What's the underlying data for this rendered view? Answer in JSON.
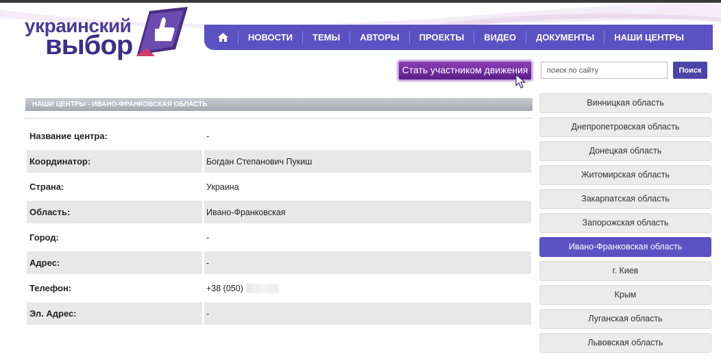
{
  "logo": {
    "line1": "украинский",
    "line2": "выбор"
  },
  "nav": {
    "items": [
      {
        "label": "НОВОСТИ"
      },
      {
        "label": "ТЕМЫ"
      },
      {
        "label": "АВТОРЫ"
      },
      {
        "label": "ПРОЕКТЫ"
      },
      {
        "label": "ВИДЕО"
      },
      {
        "label": "ДОКУМЕНТЫ"
      },
      {
        "label": "НАШИ ЦЕНТРЫ"
      }
    ]
  },
  "join_button": "Стать участником движения",
  "search": {
    "placeholder": "поиск по сайту",
    "button_label": "Поиск"
  },
  "section_title": "НАШИ ЦЕНТРЫ - ИВАНО-ФРАНКОВСКАЯ ОБЛАСТЬ",
  "info_rows": [
    {
      "label": "Название центра:",
      "value": "-"
    },
    {
      "label": "Координатор:",
      "value": "Богдан Степанович Пукиш"
    },
    {
      "label": "Страна:",
      "value": "Украина"
    },
    {
      "label": "Область:",
      "value": "Ивано-Франковская"
    },
    {
      "label": "Город:",
      "value": "-"
    },
    {
      "label": "Адрес:",
      "value": "-"
    },
    {
      "label": "Телефон:",
      "value": "+38 (050)"
    },
    {
      "label": "Эл. Адрес:",
      "value": "-"
    }
  ],
  "regions": [
    {
      "label": "Винницкая область",
      "active": false
    },
    {
      "label": "Днепропетровская область",
      "active": false
    },
    {
      "label": "Донецкая область",
      "active": false
    },
    {
      "label": "Житомирская область",
      "active": false
    },
    {
      "label": "Закарпатская область",
      "active": false
    },
    {
      "label": "Запорожская область",
      "active": false
    },
    {
      "label": "Ивано-Франковская область",
      "active": true
    },
    {
      "label": "г. Киев",
      "active": false
    },
    {
      "label": "Крым",
      "active": false
    },
    {
      "label": "Луганская область",
      "active": false
    },
    {
      "label": "Львовская область",
      "active": false
    }
  ],
  "colors": {
    "brand_purple": "#5a52c2",
    "join_button": "#6b2a9b",
    "row_alt": "#e8e8e8"
  }
}
